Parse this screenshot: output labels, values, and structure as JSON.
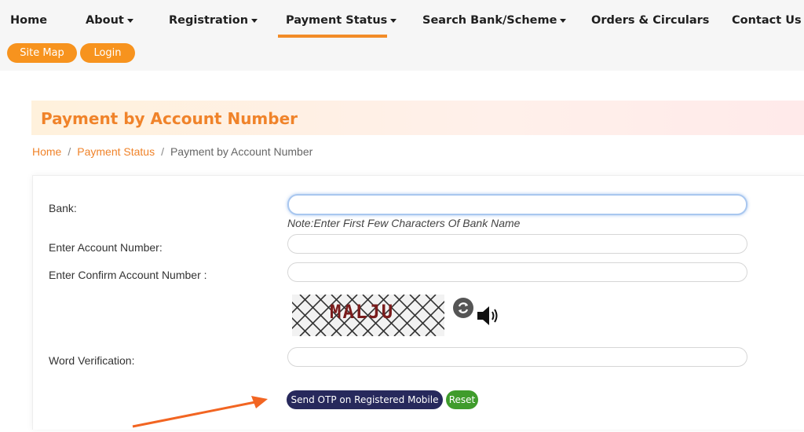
{
  "nav": {
    "items": [
      {
        "label": "Home",
        "dropdown": false
      },
      {
        "label": "About",
        "dropdown": true
      },
      {
        "label": "Registration",
        "dropdown": true
      },
      {
        "label": "Payment Status",
        "dropdown": true,
        "active": true
      },
      {
        "label": "Search Bank/Scheme",
        "dropdown": true
      },
      {
        "label": "Orders & Circulars",
        "dropdown": false
      },
      {
        "label": "Contact Us",
        "dropdown": true
      }
    ],
    "quick_links": [
      "Site Map",
      "Login"
    ],
    "accent_color": "#f28c28"
  },
  "page": {
    "title": "Payment by Account Number",
    "breadcrumb": [
      "Home",
      "Payment Status",
      "Payment by Account Number"
    ]
  },
  "form": {
    "bank_label": "Bank:",
    "bank_value": "",
    "bank_note": "Note:Enter First Few Characters Of Bank Name",
    "account_label": "Enter Account Number:",
    "account_value": "",
    "confirm_label": "Enter Confirm Account Number :",
    "confirm_value": "",
    "captcha_text": "MALJU",
    "word_label": "Word Verification:",
    "word_value": "",
    "send_otp_label": "Send OTP on Registered Mobile No",
    "reset_label": "Reset"
  },
  "icons": {
    "refresh": "refresh-icon",
    "speaker": "speaker-icon",
    "caret": "caret-down-icon",
    "annotation_arrow": "arrow-icon"
  },
  "colors": {
    "title": "#f0832a",
    "otp_button": "#27295c",
    "reset_button": "#3f9c2c",
    "arrow": "#f26522"
  }
}
